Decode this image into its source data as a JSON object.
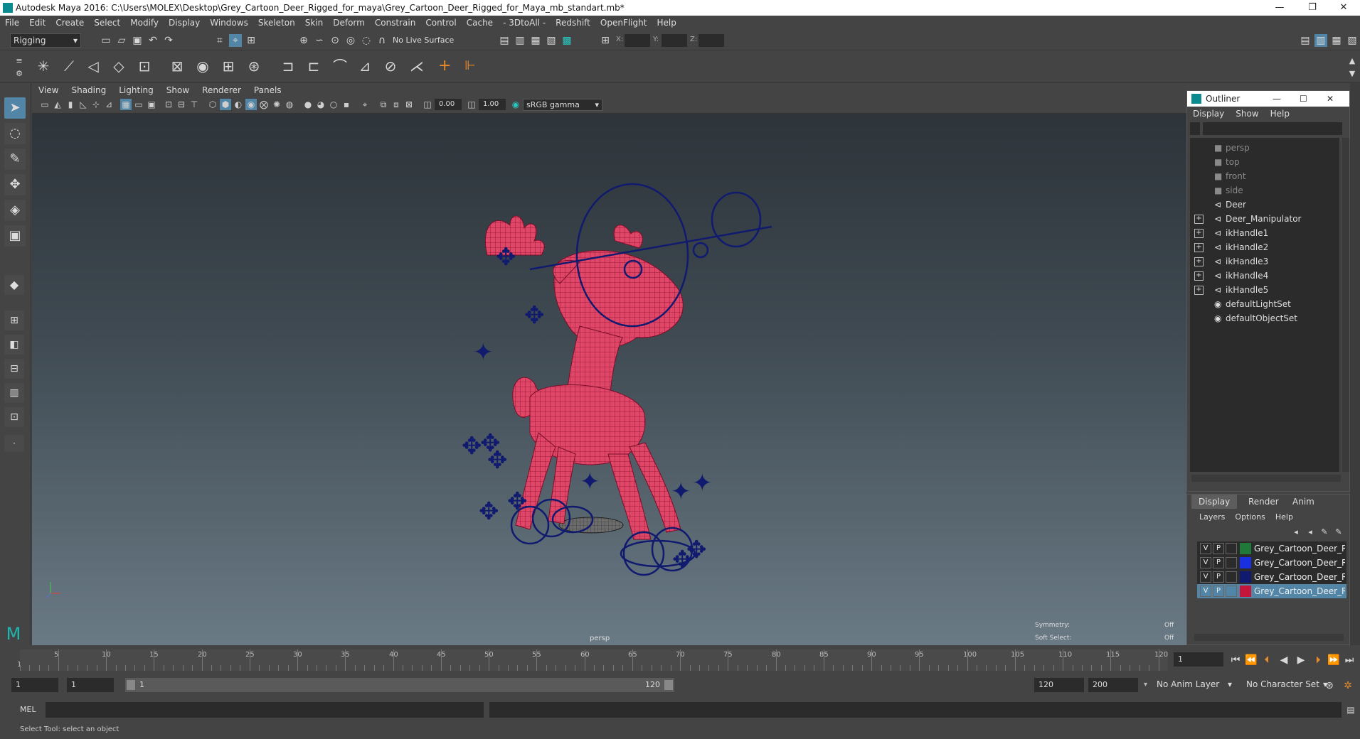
{
  "window": {
    "title": "Autodesk Maya 2016: C:\\Users\\MOLEX\\Desktop\\Grey_Cartoon_Deer_Rigged_for_maya\\Grey_Cartoon_Deer_Rigged_for_Maya_mb_standart.mb*",
    "min": "—",
    "restore": "❐",
    "close": "✕"
  },
  "menu": [
    "File",
    "Edit",
    "Create",
    "Select",
    "Modify",
    "Display",
    "Windows",
    "Skeleton",
    "Skin",
    "Deform",
    "Constrain",
    "Control",
    "Cache",
    "- 3DtoAll -",
    "Redshift",
    "OpenFlight",
    "Help"
  ],
  "toolbar": {
    "mode": "Rigging",
    "live_surface": "No Live Surface",
    "x_label": "X:",
    "y_label": "Y:",
    "z_label": "Z:"
  },
  "viewport": {
    "menu": [
      "View",
      "Shading",
      "Lighting",
      "Show",
      "Renderer",
      "Panels"
    ],
    "exposure": "0.00",
    "gamma": "1.00",
    "colorspace": "sRGB gamma",
    "camera": "persp",
    "symmetry_label": "Symmetry:",
    "symmetry_value": "Off",
    "softselect_label": "Soft Select:",
    "softselect_value": "Off"
  },
  "outliner": {
    "title": "Outliner",
    "menu": [
      "Display",
      "Show",
      "Help"
    ],
    "items": [
      {
        "label": "persp",
        "dim": true,
        "expand": false
      },
      {
        "label": "top",
        "dim": true,
        "expand": false
      },
      {
        "label": "front",
        "dim": true,
        "expand": false
      },
      {
        "label": "side",
        "dim": true,
        "expand": false
      },
      {
        "label": "Deer",
        "dim": false,
        "expand": false
      },
      {
        "label": "Deer_Manipulator",
        "dim": false,
        "expand": true
      },
      {
        "label": "ikHandle1",
        "dim": false,
        "expand": true
      },
      {
        "label": "ikHandle2",
        "dim": false,
        "expand": true
      },
      {
        "label": "ikHandle3",
        "dim": false,
        "expand": true
      },
      {
        "label": "ikHandle4",
        "dim": false,
        "expand": true
      },
      {
        "label": "ikHandle5",
        "dim": false,
        "expand": true
      },
      {
        "label": "defaultLightSet",
        "dim": false,
        "expand": false
      },
      {
        "label": "defaultObjectSet",
        "dim": false,
        "expand": false
      }
    ]
  },
  "layers": {
    "tabs": [
      "Display",
      "Render",
      "Anim"
    ],
    "menu": [
      "Layers",
      "Options",
      "Help"
    ],
    "rows": [
      {
        "v": "V",
        "p": "P",
        "color": "#1f7a3a",
        "name": "Grey_Cartoon_Deer_Rig",
        "selected": false
      },
      {
        "v": "V",
        "p": "P",
        "color": "#1a2fe0",
        "name": "Grey_Cartoon_Deer_Rig",
        "selected": false
      },
      {
        "v": "V",
        "p": "P",
        "color": "#101a6e",
        "name": "Grey_Cartoon_Deer_Rig",
        "selected": false
      },
      {
        "v": "V",
        "p": "P",
        "color": "#c4163a",
        "name": "Grey_Cartoon_Deer_Rig",
        "selected": true
      }
    ]
  },
  "timeline": {
    "ticks": [
      "5",
      "10",
      "15",
      "20",
      "25",
      "30",
      "35",
      "40",
      "45",
      "50",
      "55",
      "60",
      "65",
      "70",
      "75",
      "80",
      "85",
      "90",
      "95",
      "100",
      "105",
      "110",
      "115",
      "120"
    ],
    "start_marker": "1",
    "current_frame": "1"
  },
  "range": {
    "start": "1",
    "playback_start": "1",
    "slider_start": "1",
    "slider_end": "120",
    "playback_end": "120",
    "end": "200",
    "anim_layer": "No Anim Layer",
    "char_set": "No Character Set"
  },
  "cmd": {
    "label": "MEL"
  },
  "status": {
    "text": "Select Tool: select an object"
  }
}
